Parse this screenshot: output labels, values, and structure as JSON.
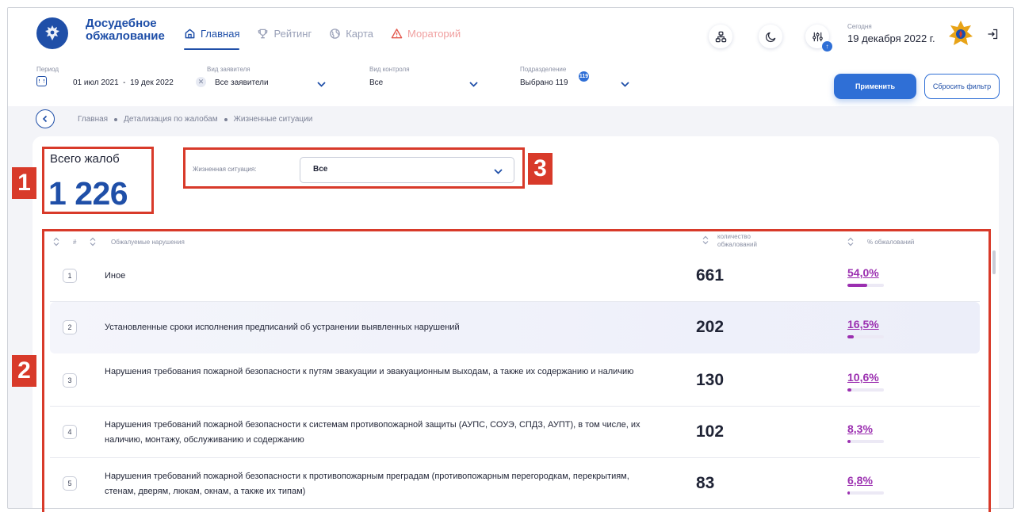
{
  "header": {
    "brand_line1": "Досудебное",
    "brand_line2": "обжалование",
    "nav": [
      {
        "label": "Главная",
        "icon": "home-icon",
        "active": true
      },
      {
        "label": "Рейтинг",
        "icon": "trophy-icon"
      },
      {
        "label": "Карта",
        "icon": "globe-icon"
      },
      {
        "label": "Мораторий",
        "icon": "warning-icon"
      }
    ],
    "today_label": "Сегодня",
    "today_value": "19 декабря 2022 г.",
    "accent": "#1f4fa8"
  },
  "filters": {
    "period_label": "Период",
    "period_value": "01 июл 2021  -  19 дек 2022",
    "applicant_label": "Вид заявителя",
    "applicant_value": "Все заявители",
    "control_label": "Вид контроля",
    "control_value": "Все",
    "division_label": "Подразделение",
    "division_badge": "119",
    "division_value": "Выбрано 119",
    "apply_label": "Применить",
    "reset_label": "Сбросить фильтр"
  },
  "breadcrumb": [
    "Главная",
    "Детализация по жалобам",
    "Жизненные ситуации"
  ],
  "summary": {
    "title": "Всего жалоб",
    "value": "1 226"
  },
  "situation": {
    "label": "Жизненная ситуация:",
    "value": "Все"
  },
  "annotations": {
    "tag1": "1",
    "tag2": "2",
    "tag3": "3",
    "color": "#d83a2a"
  },
  "table": {
    "col_num": "#",
    "col_violation": "Обжалуемые нарушения",
    "col_count_1": "количество",
    "col_count_2": "обжалований",
    "col_pct": "% обжалований",
    "rows": [
      {
        "num": "1",
        "violation": "Иное",
        "count": "661",
        "pct": "54,0%",
        "pct_value": 54.0
      },
      {
        "num": "2",
        "violation": "Установленные сроки исполнения предписаний об устранении выявленных нарушений",
        "count": "202",
        "pct": "16,5%",
        "pct_value": 16.5
      },
      {
        "num": "3",
        "violation": "Нарушения требования пожарной безопасности к путям эвакуации и эвакуационным выходам, а также их содержанию и наличию",
        "count": "130",
        "pct": "10,6%",
        "pct_value": 10.6
      },
      {
        "num": "4",
        "violation": "Нарушения требований пожарной безопасности к системам противопожарной защиты (АУПС, СОУЭ, СПДЗ, АУПТ), в том числе, их наличию, монтажу, обслуживанию и содержанию",
        "count": "102",
        "pct": "8,3%",
        "pct_value": 8.3
      },
      {
        "num": "5",
        "violation": "Нарушения требований пожарной безопасности к противопожарным преградам (противопожарным перегородкам, перекрытиям, стенам, дверям, люкам, окнам, а также их типам)",
        "count": "83",
        "pct": "6,8%",
        "pct_value": 6.8
      }
    ]
  }
}
